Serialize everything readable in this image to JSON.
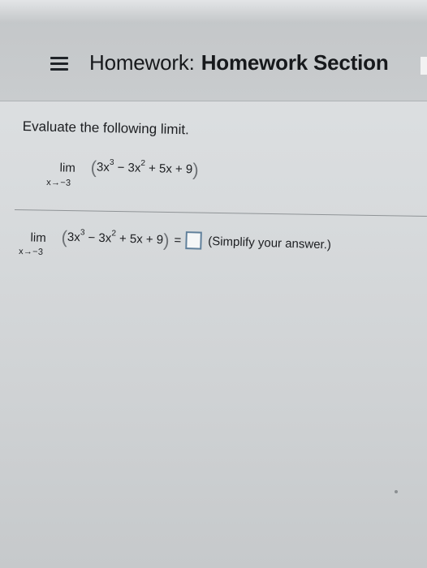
{
  "header": {
    "menu_icon": "hamburger-menu-icon",
    "title_prefix": "Homework:",
    "title_section": "Homework Section"
  },
  "question": {
    "prompt": "Evaluate the following limit.",
    "limit": {
      "lim_word": "lim",
      "approach": "x→−3",
      "expr_a": "3x",
      "exp_a": "3",
      "expr_b": " − 3x",
      "exp_b": "2",
      "expr_c": " + 5x + 9"
    }
  },
  "answer_row": {
    "equals": "=",
    "answer_value": "",
    "hint": "(Simplify your answer.)"
  }
}
